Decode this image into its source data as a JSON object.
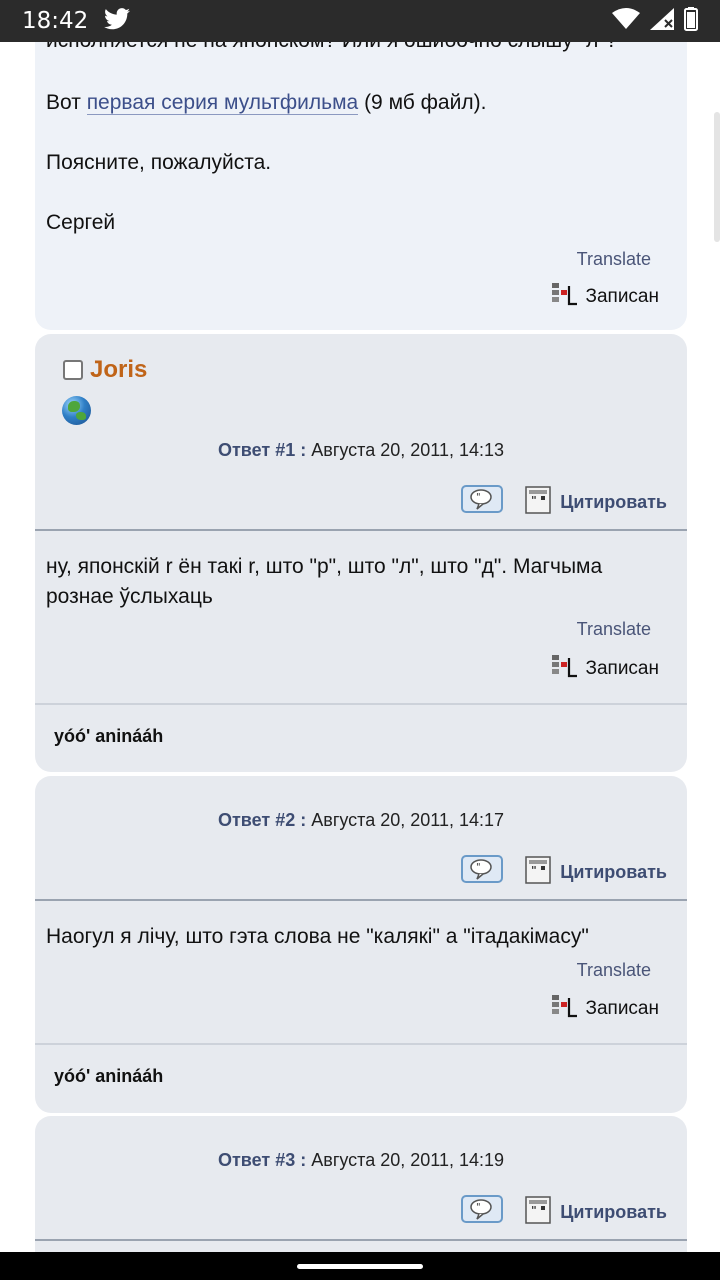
{
  "status_bar": {
    "time": "18:42",
    "icons": [
      "twitter-icon",
      "wifi-icon",
      "signal-icon",
      "battery-icon"
    ]
  },
  "post0": {
    "clipped_line": "исполняется не на японском? Или я ошибочно слышу \"л\"?",
    "link_prefix": "Вот ",
    "link_text": "первая серия мультфильма",
    "link_suffix": " (9 мб файл).",
    "line2": "Поясните, пожалуйста.",
    "line3": "Сергей",
    "translate": "Translate",
    "recorded": "Записан"
  },
  "post1": {
    "author": "Joris",
    "reply_label": "Ответ #1",
    "reply_sep": " : ",
    "date": "Августа 20, 2011, 14:13",
    "quote_label": "Цитировать",
    "text_line1": "ну, японскій r ён такі r, што \"р\", што \"л\", што \"д\". Магчыма",
    "text_line2": "рознае ўслыхаць",
    "translate": "Translate",
    "recorded": "Записан",
    "signature": "yóó' aninááh"
  },
  "post2": {
    "reply_label": "Ответ #2",
    "reply_sep": " : ",
    "date": "Августа 20, 2011, 14:17",
    "quote_label": "Цитировать",
    "text_line1": "Наогул я лічу, што гэта слова не \"калякі\" а \"ітадакімасу\"",
    "translate": "Translate",
    "recorded": "Записан",
    "signature": "yóó' aninááh"
  },
  "post3": {
    "reply_label": "Ответ #3",
    "reply_sep": " : ",
    "date": "Августа 20, 2011, 14:19",
    "quote_label": "Цитировать"
  }
}
